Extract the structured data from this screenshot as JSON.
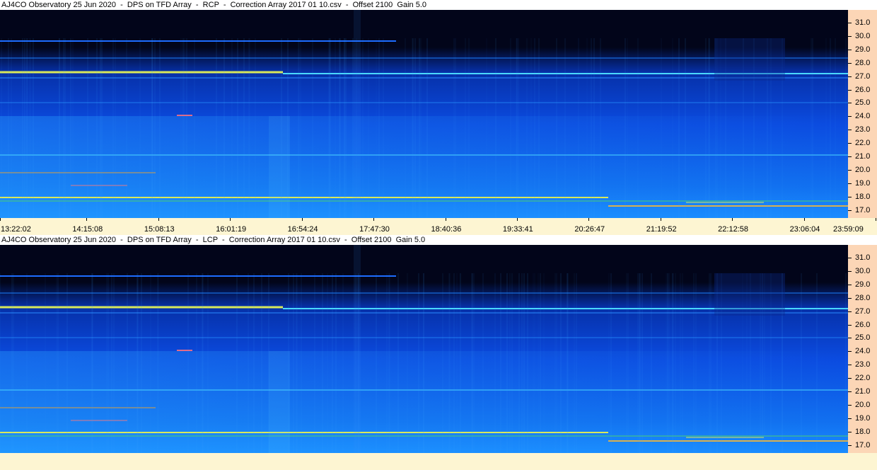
{
  "panels": [
    {
      "id": "rcp",
      "title": "AJ4CO Observatory 25 Jun 2020  -  DPS on TFD Array  -  RCP  -  Correction Array 2017 01 10.csv  -  Offset 2100  Gain 5.0",
      "show_time_labels": true
    },
    {
      "id": "lcp",
      "title": "AJ4CO Observatory 25 Jun 2020  -  DPS on TFD Array  -  LCP  -  Correction Array 2017 01 10.csv  -  Offset 2100  Gain 5.0",
      "show_time_labels": false
    }
  ],
  "freq_labels": [
    "31.0",
    "30.0",
    "29.0",
    "28.0",
    "27.0",
    "26.0",
    "25.0",
    "24.0",
    "23.0",
    "22.0",
    "21.0",
    "20.0",
    "19.0",
    "18.0",
    "17.0"
  ],
  "time_labels": [
    "13:22:02",
    "14:15:08",
    "15:08:13",
    "16:01:19",
    "16:54:24",
    "17:47:30",
    "18:40:36",
    "19:33:41",
    "20:26:47",
    "21:19:52",
    "22:12:58",
    "23:06:04",
    "23:59:09"
  ],
  "colors": {
    "axis_bg": "#fcd6b6",
    "footer_bg": "#fdf5d2",
    "sky_top": "#02051a",
    "spectrum_base": "#0b4be0",
    "spectrum_bright": "#1a8cff",
    "band_yellow": "#d8e85a",
    "band_cyan": "#4ad8ff"
  }
}
